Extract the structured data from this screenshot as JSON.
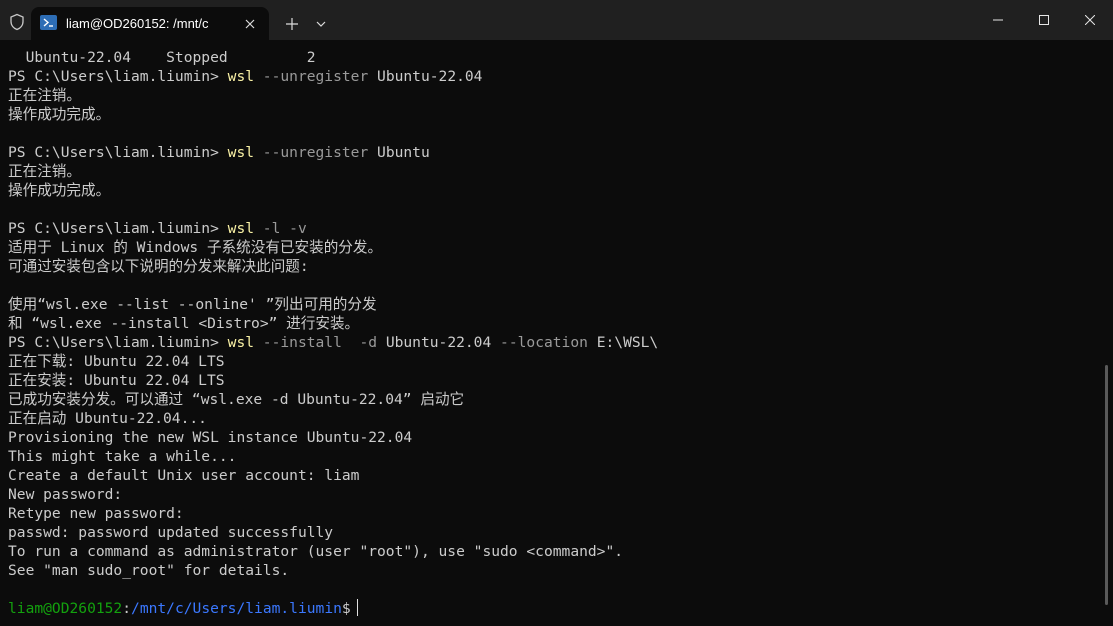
{
  "window": {
    "tab_title": "liam@OD260152: /mnt/c",
    "icons": {
      "shield": "shield-icon",
      "terminal": "terminal-icon",
      "close": "close-icon",
      "new_tab": "plus-icon",
      "dropdown": "chevron-down-icon",
      "minimize": "minimize-icon",
      "maximize": "maximize-icon",
      "window_close": "window-close-icon"
    }
  },
  "colors": {
    "background": "#0c0c0c",
    "text": "#cccccc",
    "command": "#f9f1a5",
    "argument": "#9a9a9a",
    "prompt_user": "#13a10e",
    "prompt_path": "#3b78ff"
  },
  "terminal": {
    "lines": [
      {
        "text": "  Ubuntu-22.04    Stopped         2"
      },
      {
        "prompt": "PS C:\\Users\\liam.liumin> ",
        "cmd": "wsl",
        "args": " --unregister",
        "rest": " Ubuntu-22.04"
      },
      {
        "text": "正在注销。"
      },
      {
        "text": "操作成功完成。"
      },
      {
        "text": ""
      },
      {
        "prompt": "PS C:\\Users\\liam.liumin> ",
        "cmd": "wsl",
        "args": " --unregister",
        "rest": " Ubuntu"
      },
      {
        "text": "正在注销。"
      },
      {
        "text": "操作成功完成。"
      },
      {
        "text": ""
      },
      {
        "prompt": "PS C:\\Users\\liam.liumin> ",
        "cmd": "wsl",
        "args": " -l -v",
        "rest": ""
      },
      {
        "text": "适用于 Linux 的 Windows 子系统没有已安装的分发。"
      },
      {
        "text": "可通过安装包含以下说明的分发来解决此问题:"
      },
      {
        "text": ""
      },
      {
        "text": "使用“wsl.exe --list --online' ”列出可用的分发"
      },
      {
        "text": "和 “wsl.exe --install <Distro>” 进行安装。"
      },
      {
        "prompt": "PS C:\\Users\\liam.liumin> ",
        "cmd": "wsl",
        "args": " --install  -d",
        "rest": " Ubuntu-22.04",
        "args2": " --location",
        "rest2": " E:\\WSL\\"
      },
      {
        "text": "正在下载: Ubuntu 22.04 LTS"
      },
      {
        "text": "正在安装: Ubuntu 22.04 LTS"
      },
      {
        "text": "已成功安装分发。可以通过 “wsl.exe -d Ubuntu-22.04” 启动它"
      },
      {
        "text": "正在启动 Ubuntu-22.04..."
      },
      {
        "text": "Provisioning the new WSL instance Ubuntu-22.04"
      },
      {
        "text": "This might take a while..."
      },
      {
        "text": "Create a default Unix user account: liam"
      },
      {
        "text": "New password:"
      },
      {
        "text": "Retype new password:"
      },
      {
        "text": "passwd: password updated successfully"
      },
      {
        "text": "To run a command as administrator (user \"root\"), use \"sudo <command>\"."
      },
      {
        "text": "See \"man sudo_root\" for details."
      },
      {
        "text": ""
      }
    ],
    "bash_prompt": {
      "user": "liam@OD260152",
      "colon": ":",
      "path": "/mnt/c/Users/liam.liumin",
      "symbol": "$"
    }
  }
}
